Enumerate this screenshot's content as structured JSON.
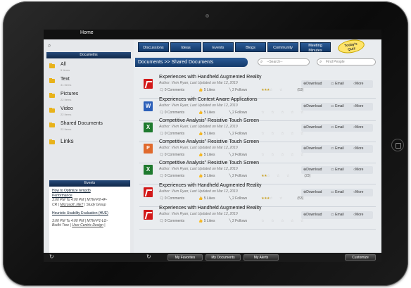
{
  "app": {
    "title": "Home"
  },
  "sidebar": {
    "heading": "Documetns",
    "libraries": [
      {
        "name": "All",
        "count": "5 Items"
      },
      {
        "name": "Text",
        "count": "31 Items"
      },
      {
        "name": "Pictures",
        "count": "22 Items"
      },
      {
        "name": "Video",
        "count": "22 Items"
      },
      {
        "name": "Shared Documents",
        "count": "22 Items"
      },
      {
        "name": "Links",
        "count": ""
      }
    ]
  },
  "events": {
    "heading": "Events",
    "items": [
      {
        "title_l1": "How to Optimize tempdb",
        "title_l2": "Performance",
        "meta_l1": "3:00 PM To 4:00 PM | MTW-P2-4F-",
        "meta_l2_a": "CR | ",
        "meta_l2_link": "Microsoft .NET",
        "meta_l2_b": " | Study Group"
      },
      {
        "title_l1": "Heuristic Usability Evaluation (HUE)",
        "title_l2": "",
        "meta_l1": "3:00 PM To 4:00 PM | MTW-P1-LG-",
        "meta_l2_a": "Bodhi Tree | ",
        "meta_l2_link": "User Centric Design",
        "meta_l2_b": " |"
      }
    ]
  },
  "tabs": [
    {
      "label": "Discussions"
    },
    {
      "label": "Ideas"
    },
    {
      "label": "Events"
    },
    {
      "label": "Blogs"
    },
    {
      "label": "Community"
    },
    {
      "label_l1": "Meeting",
      "label_l2": "Minutes"
    }
  ],
  "quiz": {
    "l1": "Today's",
    "l2": "Quiz"
  },
  "breadcrumb": "Documents >> Shared Documents",
  "search": {
    "placeholder": "--Search--"
  },
  "people_search": {
    "placeholder": "Find People"
  },
  "documents": [
    {
      "icon": "pdf-icon",
      "title": "Experiences with Handheld Augmented Reality",
      "author": "Author: Vivin Ryan; Last Updated on Mar 12, 2010",
      "comments": "0 Comments",
      "likes": "5 Likes",
      "follows": "2 Follows",
      "rating": 3,
      "votes": "(53)"
    },
    {
      "icon": "word-icon",
      "title": "Experiences with Context Aware Applications",
      "author": "Author: Vivin Ryan; Last Updated on Mar 12, 2010",
      "comments": "0 Comments",
      "likes": "5 Likes",
      "follows": "2 Follows",
      "rating": 0,
      "votes": ""
    },
    {
      "icon": "excel-icon",
      "title": "Competitive Analysis\" Resistive Touch Screen",
      "author": "Author: Vivin Ryan; Last Updated on Mar 12, 2010",
      "comments": "0 Comments",
      "likes": "5 Likes",
      "follows": "2 Follows",
      "rating": 0,
      "votes": ""
    },
    {
      "icon": "ppt-icon",
      "title": "Competitive Analysis\" Resistive Touch Screen",
      "author": "Author: Vivin Ryan; Last Updated on Mar 12, 2010",
      "comments": "0 Comments",
      "likes": "5 Likes",
      "follows": "2 Follows",
      "rating": 0,
      "votes": ""
    },
    {
      "icon": "excel-icon",
      "title": "Competitive Analysis\" Resistive Touch Screen",
      "author": "Author: Vivin Ryan; Last Updated on Mar 12, 2010",
      "comments": "0 Comments",
      "likes": "5 Likes",
      "follows": "2 Follows",
      "rating": 2,
      "votes": "(23)"
    },
    {
      "icon": "pdf-icon",
      "title": "Experiences with Handheld Augmented Reality",
      "author": "Author: Vivin Ryan; Last Updated on Mar 12, 2010",
      "comments": "0 Comments",
      "likes": "5 Likes",
      "follows": "2 Follows",
      "rating": 3,
      "votes": "(53)"
    },
    {
      "icon": "pdf-icon",
      "title": "Experiences with Handheld Augmented Reality",
      "author": "Author: Vivin Ryan; Last Updated on Mar 12, 2010",
      "comments": "0 Comments",
      "likes": "5 Likes",
      "follows": "2 Follows",
      "rating": 0,
      "votes": ""
    }
  ],
  "row_actions": {
    "download": "Download",
    "email": "Email",
    "more": "More"
  },
  "bottom": {
    "my_favorites": "My Favorites",
    "my_documents": "My Documents",
    "my_alerts": "My Alerts",
    "customize": "Customize"
  },
  "colors": {
    "accent": "#1c4a80",
    "folder": "#e8b21a",
    "star": "#c9a227"
  }
}
